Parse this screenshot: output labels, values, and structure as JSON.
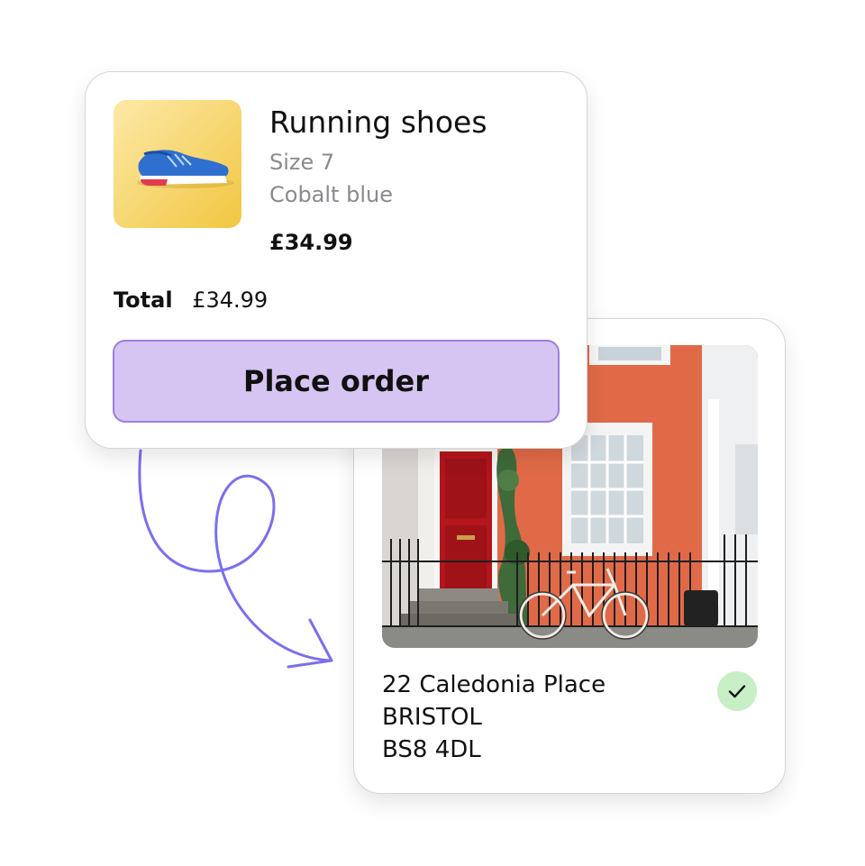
{
  "order": {
    "product_name": "Running shoes",
    "size": "Size 7",
    "color": "Cobalt blue",
    "price": "£34.99",
    "total_label": "Total",
    "total_value": "£34.99",
    "place_order_label": "Place order",
    "button_color": "#d6c4f2"
  },
  "address": {
    "line1": "22 Caledonia Place",
    "line2": "BRISTOL",
    "line3": "BS8 4DL",
    "verified_icon": "checkmark-icon",
    "verified_color": "#c8eec5"
  },
  "connector": {
    "icon": "curly-arrow-icon",
    "color": "#7a6ff0"
  }
}
